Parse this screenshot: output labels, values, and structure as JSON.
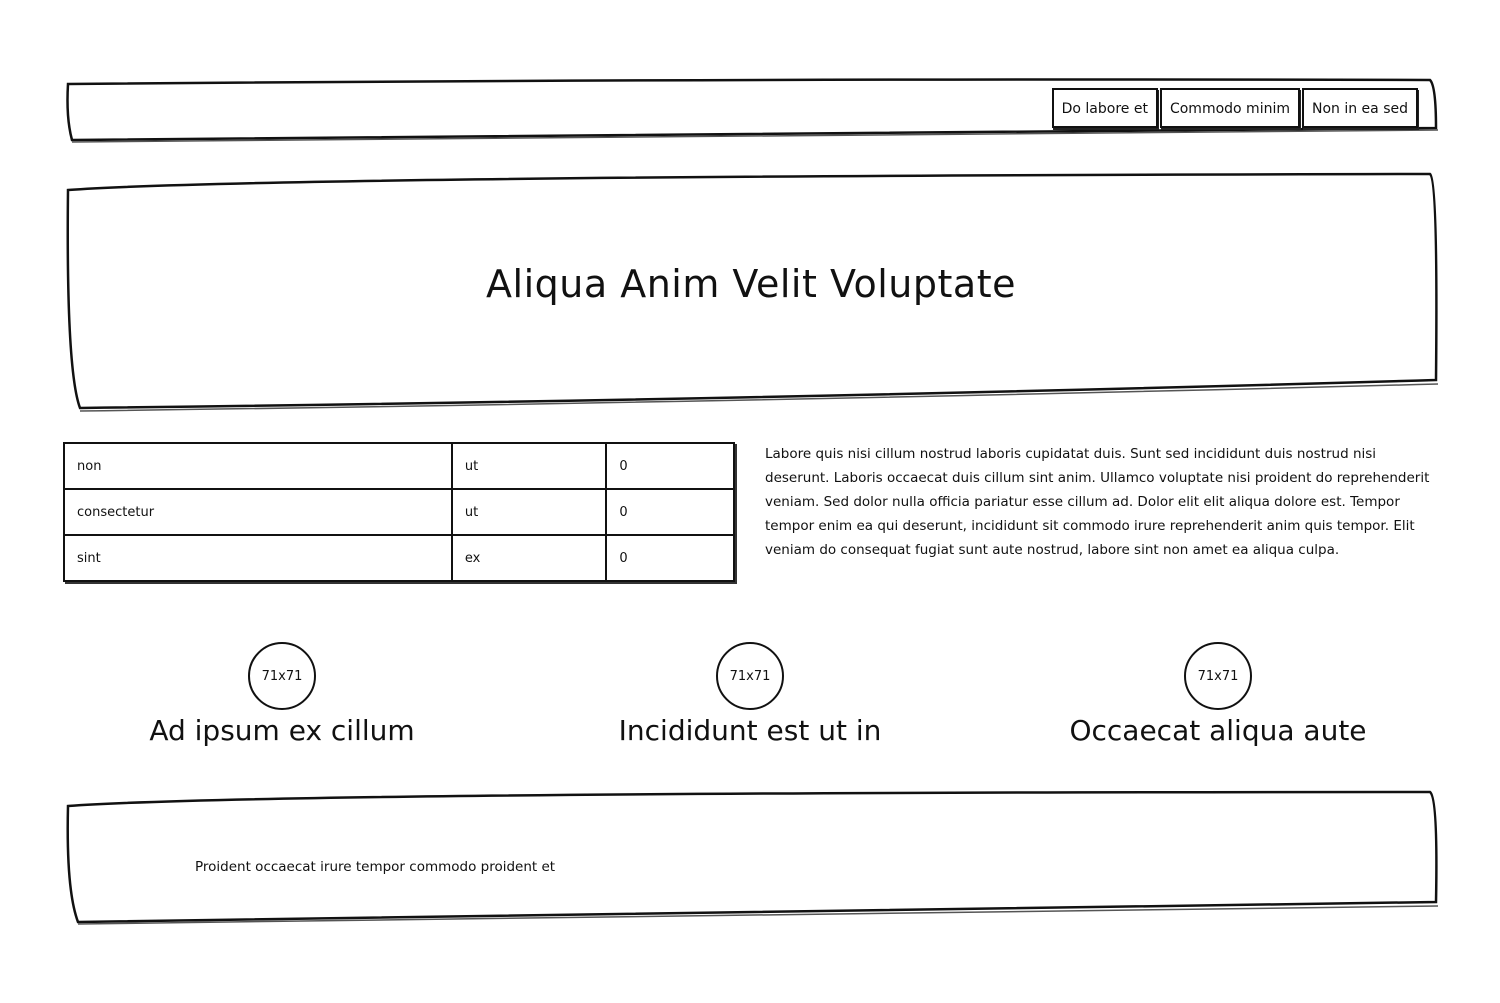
{
  "header": {
    "nav": [
      {
        "label": "Do labore et"
      },
      {
        "label": "Commodo minim"
      },
      {
        "label": "Non in ea sed"
      }
    ]
  },
  "hero": {
    "title": "Aliqua Anim Velit Voluptate"
  },
  "table": {
    "rows": [
      [
        "non",
        "ut",
        "0"
      ],
      [
        "consectetur",
        "ut",
        "0"
      ],
      [
        "sint",
        "ex",
        "0"
      ]
    ]
  },
  "paragraph": "Labore quis nisi cillum nostrud laboris cupidatat duis. Sunt sed incididunt duis nostrud nisi deserunt. Laboris occaecat duis cillum sint anim. Ullamco voluptate nisi proident do reprehenderit veniam. Sed dolor nulla officia pariatur esse cillum ad. Dolor elit elit aliqua dolore est. Tempor tempor enim ea qui deserunt, incididunt sit commodo irure reprehenderit anim quis tempor. Elit veniam do consequat fugiat sunt aute nostrud, labore sint non amet ea aliqua culpa.",
  "features": [
    {
      "image_label": "71x71",
      "title": "Ad ipsum ex cillum"
    },
    {
      "image_label": "71x71",
      "title": "Incididunt est ut in"
    },
    {
      "image_label": "71x71",
      "title": "Occaecat aliqua aute"
    }
  ],
  "footer": {
    "text": "Proident occaecat irure tempor commodo proident et"
  }
}
